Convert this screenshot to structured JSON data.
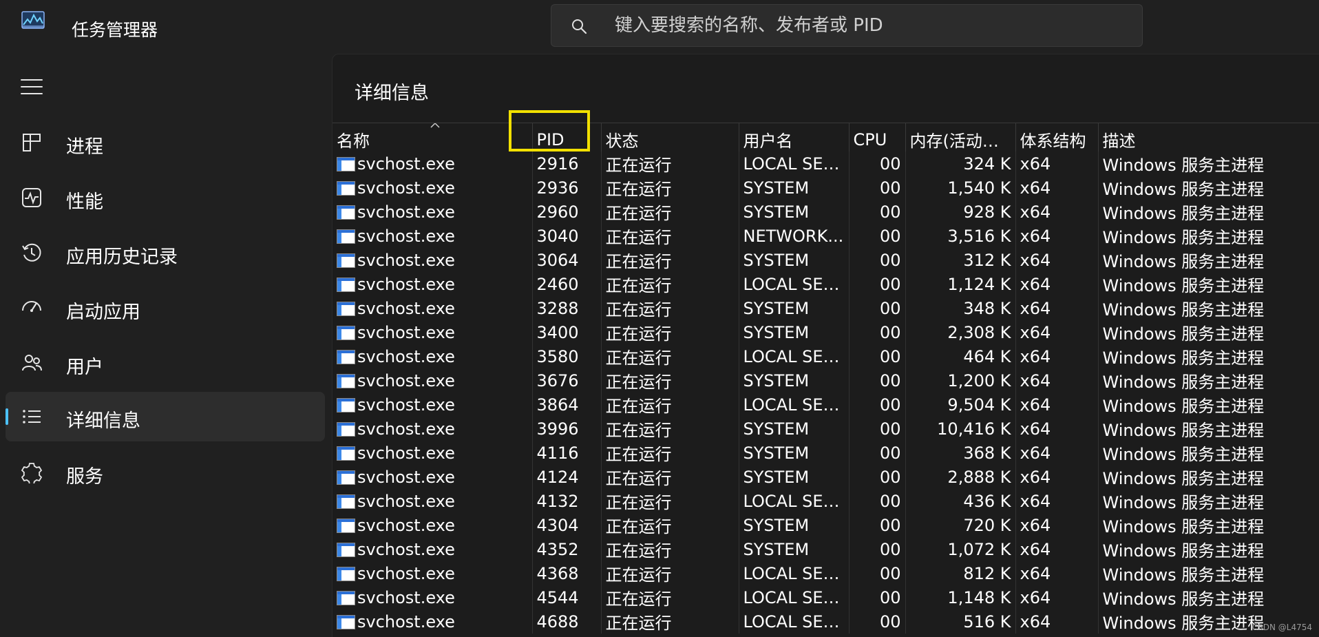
{
  "app": {
    "title": "任务管理器"
  },
  "search": {
    "placeholder": "键入要搜索的名称、发布者或 PID"
  },
  "nav": {
    "items": [
      {
        "label": "进程",
        "icon": "processes-icon",
        "active": false
      },
      {
        "label": "性能",
        "icon": "performance-icon",
        "active": false
      },
      {
        "label": "应用历史记录",
        "icon": "app-history-icon",
        "active": false
      },
      {
        "label": "启动应用",
        "icon": "startup-apps-icon",
        "active": false
      },
      {
        "label": "用户",
        "icon": "users-icon",
        "active": false
      },
      {
        "label": "详细信息",
        "icon": "details-icon",
        "active": true
      },
      {
        "label": "服务",
        "icon": "services-icon",
        "active": false
      }
    ]
  },
  "page": {
    "title": "详细信息"
  },
  "table": {
    "sorted_column": "名称",
    "columns": [
      "名称",
      "PID",
      "状态",
      "用户名",
      "CPU",
      "内存(活动的...",
      "体系结构",
      "描述"
    ],
    "rows": [
      [
        "svchost.exe",
        "2916",
        "正在运行",
        "LOCAL SER...",
        "00",
        "324 K",
        "x64",
        "Windows 服务主进程"
      ],
      [
        "svchost.exe",
        "2936",
        "正在运行",
        "SYSTEM",
        "00",
        "1,540 K",
        "x64",
        "Windows 服务主进程"
      ],
      [
        "svchost.exe",
        "2960",
        "正在运行",
        "SYSTEM",
        "00",
        "928 K",
        "x64",
        "Windows 服务主进程"
      ],
      [
        "svchost.exe",
        "3040",
        "正在运行",
        "NETWORK...",
        "00",
        "3,516 K",
        "x64",
        "Windows 服务主进程"
      ],
      [
        "svchost.exe",
        "3064",
        "正在运行",
        "SYSTEM",
        "00",
        "312 K",
        "x64",
        "Windows 服务主进程"
      ],
      [
        "svchost.exe",
        "2460",
        "正在运行",
        "LOCAL SER...",
        "00",
        "1,124 K",
        "x64",
        "Windows 服务主进程"
      ],
      [
        "svchost.exe",
        "3288",
        "正在运行",
        "SYSTEM",
        "00",
        "348 K",
        "x64",
        "Windows 服务主进程"
      ],
      [
        "svchost.exe",
        "3400",
        "正在运行",
        "SYSTEM",
        "00",
        "2,308 K",
        "x64",
        "Windows 服务主进程"
      ],
      [
        "svchost.exe",
        "3580",
        "正在运行",
        "LOCAL SER...",
        "00",
        "464 K",
        "x64",
        "Windows 服务主进程"
      ],
      [
        "svchost.exe",
        "3676",
        "正在运行",
        "SYSTEM",
        "00",
        "1,200 K",
        "x64",
        "Windows 服务主进程"
      ],
      [
        "svchost.exe",
        "3864",
        "正在运行",
        "LOCAL SER...",
        "00",
        "9,504 K",
        "x64",
        "Windows 服务主进程"
      ],
      [
        "svchost.exe",
        "3996",
        "正在运行",
        "SYSTEM",
        "00",
        "10,416 K",
        "x64",
        "Windows 服务主进程"
      ],
      [
        "svchost.exe",
        "4116",
        "正在运行",
        "SYSTEM",
        "00",
        "368 K",
        "x64",
        "Windows 服务主进程"
      ],
      [
        "svchost.exe",
        "4124",
        "正在运行",
        "SYSTEM",
        "00",
        "2,888 K",
        "x64",
        "Windows 服务主进程"
      ],
      [
        "svchost.exe",
        "4132",
        "正在运行",
        "LOCAL SER...",
        "00",
        "436 K",
        "x64",
        "Windows 服务主进程"
      ],
      [
        "svchost.exe",
        "4304",
        "正在运行",
        "SYSTEM",
        "00",
        "720 K",
        "x64",
        "Windows 服务主进程"
      ],
      [
        "svchost.exe",
        "4352",
        "正在运行",
        "SYSTEM",
        "00",
        "1,072 K",
        "x64",
        "Windows 服务主进程"
      ],
      [
        "svchost.exe",
        "4368",
        "正在运行",
        "LOCAL SER...",
        "00",
        "812 K",
        "x64",
        "Windows 服务主进程"
      ],
      [
        "svchost.exe",
        "4544",
        "正在运行",
        "LOCAL SER...",
        "00",
        "1,148 K",
        "x64",
        "Windows 服务主进程"
      ],
      [
        "svchost.exe",
        "4688",
        "正在运行",
        "LOCAL SER...",
        "00",
        "516 K",
        "x64",
        "Windows 服务主进程"
      ]
    ]
  },
  "watermark": "CSDN @L4754",
  "colors": {
    "accent": "#4cc2ff",
    "highlight": "#f2e000",
    "background": "#202020",
    "panel": "#1c1c1c"
  }
}
